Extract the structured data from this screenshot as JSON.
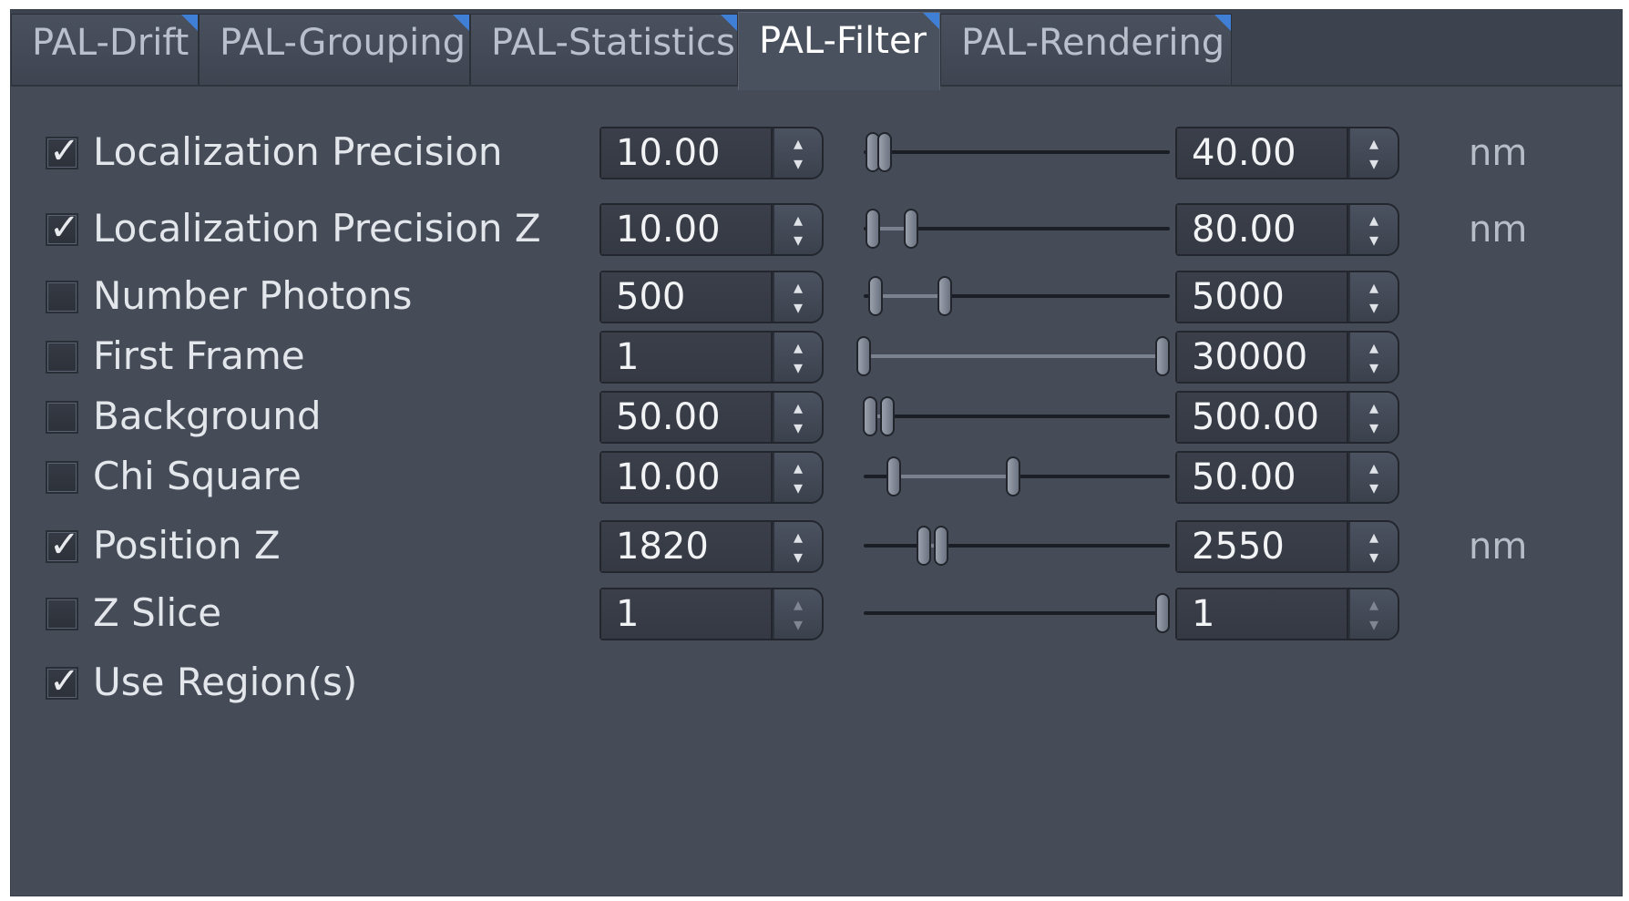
{
  "tabs": [
    "PAL-Drift",
    "PAL-Grouping",
    "PAL-Statistics",
    "PAL-Filter",
    "PAL-Rendering"
  ],
  "active_tab": "PAL-Filter",
  "accent_color": "#3f7fd6",
  "check_glyph": "✓",
  "arrow_up": "▴",
  "arrow_down": "▾",
  "filters": [
    {
      "label": "Localization Precision",
      "checked": true,
      "min": "10.00",
      "max": "40.00",
      "unit": "nm",
      "range": [
        0.03,
        0.07
      ],
      "enabled": true
    },
    {
      "label": "Localization Precision Z",
      "checked": true,
      "min": "10.00",
      "max": "80.00",
      "unit": "nm",
      "range": [
        0.03,
        0.16
      ],
      "enabled": true
    },
    {
      "label": "Number Photons",
      "checked": false,
      "min": "500",
      "max": "5000",
      "unit": "",
      "range": [
        0.04,
        0.27
      ],
      "enabled": true
    },
    {
      "label": "First Frame",
      "checked": false,
      "min": "1",
      "max": "30000",
      "unit": "",
      "range": [
        0.0,
        1.0
      ],
      "enabled": true
    },
    {
      "label": "Background",
      "checked": false,
      "min": "50.00",
      "max": "500.00",
      "unit": "",
      "range": [
        0.02,
        0.08
      ],
      "enabled": true
    },
    {
      "label": "Chi Square",
      "checked": false,
      "min": "10.00",
      "max": "50.00",
      "unit": "",
      "range": [
        0.1,
        0.5
      ],
      "enabled": true
    },
    {
      "label": "Position Z",
      "checked": true,
      "min": "1820",
      "max": "2550",
      "unit": "nm",
      "range": [
        0.2,
        0.26
      ],
      "enabled": true
    },
    {
      "label": "Z Slice",
      "checked": false,
      "min": "1",
      "max": "1",
      "unit": "",
      "range": [
        1.0,
        1.0
      ],
      "enabled": false
    }
  ],
  "use_regions": {
    "label": "Use Region(s)",
    "checked": true
  }
}
